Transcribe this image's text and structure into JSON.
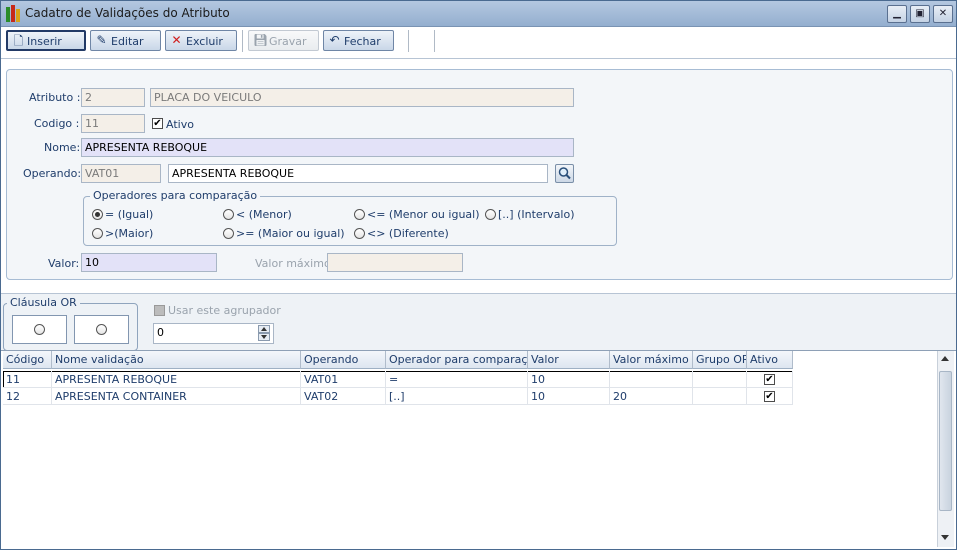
{
  "window": {
    "title": "Cadatro de Validações do Atributo"
  },
  "toolbar": {
    "inserir": "Inserir",
    "editar": "Editar",
    "excluir": "Excluir",
    "gravar": "Gravar",
    "fechar": "Fechar"
  },
  "form": {
    "atributo_label": "Atributo :",
    "atributo_id": "2",
    "atributo_desc": "PLACA DO VEICULO",
    "codigo_label": "Codigo :",
    "codigo_value": "11",
    "ativo_label": "Ativo",
    "ativo_checked": true,
    "nome_label": "Nome:",
    "nome_value": "APRESENTA REBOQUE",
    "operando_label": "Operando:",
    "operando_code": "VAT01",
    "operando_desc": "APRESENTA REBOQUE",
    "operadores_title": "Operadores para comparação",
    "operadores": [
      {
        "label": "= (Igual)",
        "selected": true
      },
      {
        "label": "< (Menor)",
        "selected": false
      },
      {
        "label": "<= (Menor ou igual)",
        "selected": false
      },
      {
        "label": "[..] (Intervalo)",
        "selected": false
      },
      {
        "label": ">(Maior)",
        "selected": false
      },
      {
        "label": ">= (Maior ou igual)",
        "selected": false
      },
      {
        "label": "<> (Diferente)",
        "selected": false
      }
    ],
    "valor_label": "Valor:",
    "valor_value": "10",
    "valor_max_label": "Valor máximo:",
    "valor_max_value": ""
  },
  "or_section": {
    "title": "Cláusula OR",
    "usar_label": "Usar este agrupador",
    "group_value": "0"
  },
  "grid": {
    "columns": [
      "Código",
      "Nome validação",
      "Operando",
      "Operador para comparação",
      "Valor",
      "Valor máximo",
      "Grupo OR",
      "Ativo"
    ],
    "rows": [
      {
        "codigo": "11",
        "nome": "APRESENTA REBOQUE",
        "operando": "VAT01",
        "operador": "=",
        "valor": "10",
        "valor_max": "",
        "grupo": "",
        "ativo": true
      },
      {
        "codigo": "12",
        "nome": "APRESENTA CONTAINER",
        "operando": "VAT02",
        "operador": "[..]",
        "valor": "10",
        "valor_max": "20",
        "grupo": "",
        "ativo": true
      }
    ]
  },
  "colors": {
    "label": "#1f3d6b",
    "accent": "#94afcf",
    "edit_field": "#e3e2f8"
  }
}
